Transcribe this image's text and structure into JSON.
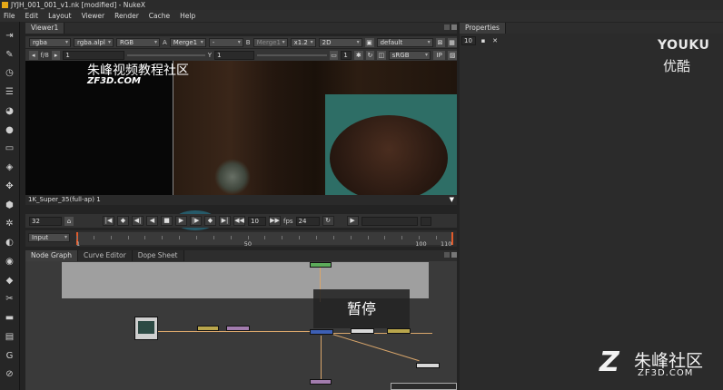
{
  "window": {
    "title": "JYJH_001_001_v1.nk [modified] - NukeX"
  },
  "menubar": [
    "File",
    "Edit",
    "Layout",
    "Viewer",
    "Render",
    "Cache",
    "Help"
  ],
  "viewer": {
    "tab_label": "Viewer1",
    "row1": {
      "channels": "rgba",
      "channels_alpha": "rgba.alpl",
      "display_channel": "RGB",
      "a_label": "A",
      "a_input": "Merge1",
      "a_minus": "-",
      "b_label": "B",
      "b_input": "Merge1",
      "zoom": "x1.2",
      "view_mode": "2D",
      "lut": "default"
    },
    "row2": {
      "fstop": "f/8",
      "gain": "1",
      "y_label": "Y",
      "gamma": "1",
      "color_space": "sRGB",
      "ip_label": "IP"
    },
    "watermark_cn": "朱峰视频教程社区",
    "watermark_en": "ZF3D.COM",
    "format": "1K_Super_35(full-ap) 1",
    "playback": {
      "current_frame": "32",
      "skip_frames": "10",
      "fps_label": "fps",
      "fps": "24"
    },
    "timeline": {
      "input_mode": "Input",
      "ticks": [
        "1",
        "50",
        "100",
        "110"
      ],
      "range_start": 1,
      "range_end": 110
    }
  },
  "node_graph": {
    "tabs": [
      "Node Graph",
      "Curve Editor",
      "Dope Sheet"
    ],
    "pause_label": "暂停",
    "node_colors": {
      "merge": "#3d5fb4",
      "grade": "#b9a64c",
      "blur": "#a27cae",
      "read": "#d9d9d9",
      "color": "#5cab5a"
    }
  },
  "properties": {
    "tab_label": "Properties",
    "max_panels": "10"
  },
  "overlays": {
    "youku_en": "YOUKU",
    "youku_cn": "优酷",
    "brand_cn": "朱峰社区",
    "brand_url": "ZF3D.COM"
  }
}
